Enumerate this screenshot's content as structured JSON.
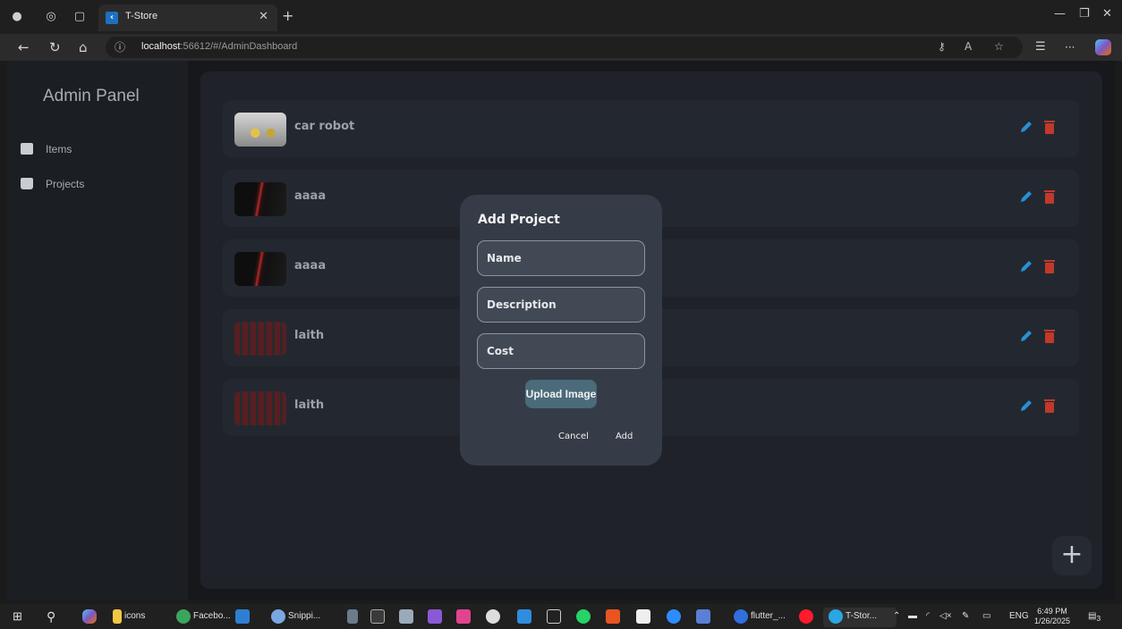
{
  "browser": {
    "tab_title": "T-Store",
    "url_host": "localhost",
    "url_rest": ":56612/#/AdminDashboard"
  },
  "sidebar": {
    "title": "Admin Panel",
    "items": [
      {
        "label": "Items",
        "icon": "archive-icon"
      },
      {
        "label": "Projects",
        "icon": "briefcase-icon"
      }
    ]
  },
  "rows": [
    {
      "title": "car robot",
      "thumb": "robot"
    },
    {
      "title": "aaaa",
      "thumb": "dark"
    },
    {
      "title": "aaaa",
      "thumb": "dark"
    },
    {
      "title": "laith",
      "thumb": "red"
    },
    {
      "title": "laith",
      "thumb": "red"
    }
  ],
  "colors": {
    "edit": "#2b8fd6",
    "delete": "#c0392b"
  },
  "dialog": {
    "title": "Add Project",
    "name_placeholder": "Name",
    "description_placeholder": "Description",
    "cost_placeholder": "Cost",
    "upload_label": "Upload Image",
    "cancel_label": "Cancel",
    "add_label": "Add"
  },
  "fab_label": "+",
  "taskbar": {
    "items": [
      {
        "label": "icons",
        "color": "#f2c744"
      },
      {
        "label": "Facebo...",
        "color": "#3ba55d"
      },
      {
        "label": "Snippi...",
        "color": "#7aa7e0"
      },
      {
        "label": "flutter_...",
        "color": "#2f6fde"
      },
      {
        "label": "T-Stor...",
        "color": "#2aa7e0"
      }
    ],
    "language": "ENG",
    "time": "6:49 PM",
    "date": "1/26/2025",
    "notification_count": "3"
  }
}
